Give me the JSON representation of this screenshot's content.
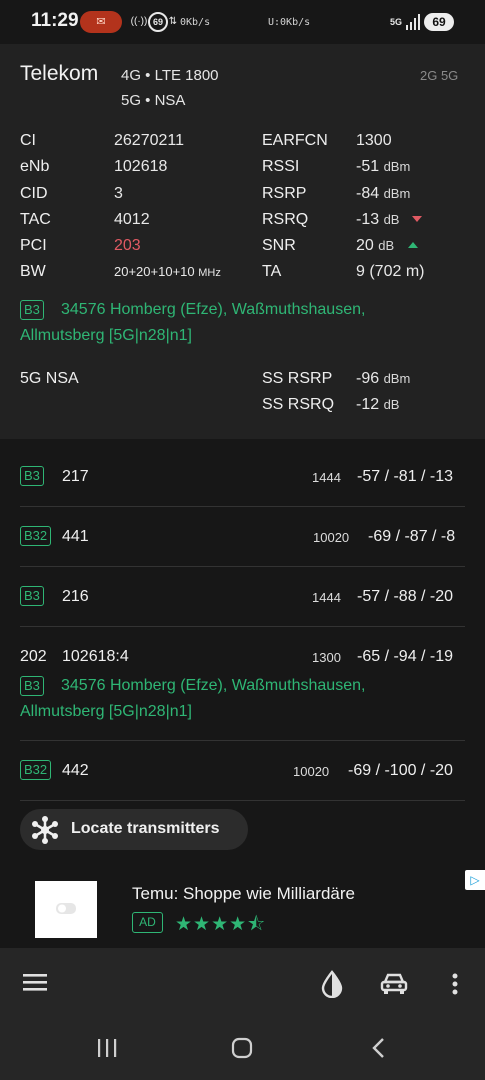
{
  "status_bar": {
    "time": "11:29",
    "pill_icon": "messages-icon",
    "net_speed_left": "0Kb/s",
    "net_speed_center": "U:0Kb/s",
    "network_badge": "5G",
    "battery": "69",
    "icons": [
      "hotspot-4cc-icon",
      "sixty-nine-icon",
      "data-arrows-icon",
      "wifi-icon",
      "signal-bars-icon"
    ]
  },
  "serving": {
    "operator": "Telekom",
    "tech_line1": "4G • LTE 1800",
    "tech_line2": "5G • NSA",
    "generations": "2G 5G",
    "left_fields": [
      {
        "label": "CI",
        "value": "26270211"
      },
      {
        "label": "eNb",
        "value": "102618"
      },
      {
        "label": "CID",
        "value": "3"
      },
      {
        "label": "TAC",
        "value": "4012"
      },
      {
        "label": "PCI",
        "value": "203"
      },
      {
        "label": "BW",
        "value": "20+20+10+10",
        "unit": "MHz"
      }
    ],
    "right_fields": [
      {
        "label": "EARFCN",
        "value": "1300",
        "unit": ""
      },
      {
        "label": "RSSI",
        "value": "-51",
        "unit": "dBm"
      },
      {
        "label": "RSRP",
        "value": "-84",
        "unit": "dBm"
      },
      {
        "label": "RSRQ",
        "value": "-13",
        "unit": "dB"
      },
      {
        "label": "SNR",
        "value": "20",
        "unit": "dB"
      },
      {
        "label": "TA",
        "value": "9 (702 m)",
        "unit": ""
      }
    ],
    "band_badge": "B3",
    "location_line1": "34576 Homberg (Efze), Waßmuthshausen,",
    "location_line2": "Allmutsberg [5G|n28|n1]",
    "nsa_label": "5G NSA",
    "nsa_fields": [
      {
        "label": "SS RSRP",
        "value": "-96",
        "unit": "dBm"
      },
      {
        "label": "SS RSRQ",
        "value": "-12",
        "unit": "dB"
      }
    ]
  },
  "neighbors": [
    {
      "band": "B3",
      "pci": "217",
      "earfcn": "1444",
      "values": "-57 / -81 / -13"
    },
    {
      "band": "B32",
      "pci": "441",
      "earfcn": "10020",
      "values": "-69 / -87 / -8"
    },
    {
      "band": "B3",
      "pci": "216",
      "earfcn": "1444",
      "values": "-57 / -88 / -20"
    },
    {
      "pci": "202",
      "cell": "102618:4",
      "earfcn": "1300",
      "values": "-65 / -94 / -19",
      "band": "B3",
      "location_line1": "34576 Homberg (Efze), Waßmuthshausen,",
      "location_line2": "Allmutsberg [5G|n28|n1]"
    },
    {
      "band": "B32",
      "pci": "442",
      "earfcn": "10020",
      "values": "-69 / -100 / -20"
    }
  ],
  "locate_button": {
    "label": "Locate transmitters",
    "icon": "transmitters-network-icon"
  },
  "ad": {
    "title": "Temu: Shoppe wie Milliardäre",
    "badge": "AD",
    "rating": 4.5,
    "stars_text": "★★★★⯪"
  },
  "bottom_bar": {
    "menu_icon": "hamburger-menu-icon",
    "theme_icon": "contrast-drop-icon",
    "car_icon": "car-icon",
    "more_icon": "more-vertical-icon"
  },
  "nav_bar": {
    "recents_icon": "recent-apps-icon",
    "home_icon": "home-icon",
    "back_icon": "back-icon"
  },
  "colors": {
    "accent_green": "#2fb675",
    "warn_red": "#e05a63",
    "panel_bg": "#222222",
    "page_bg": "#171717"
  }
}
